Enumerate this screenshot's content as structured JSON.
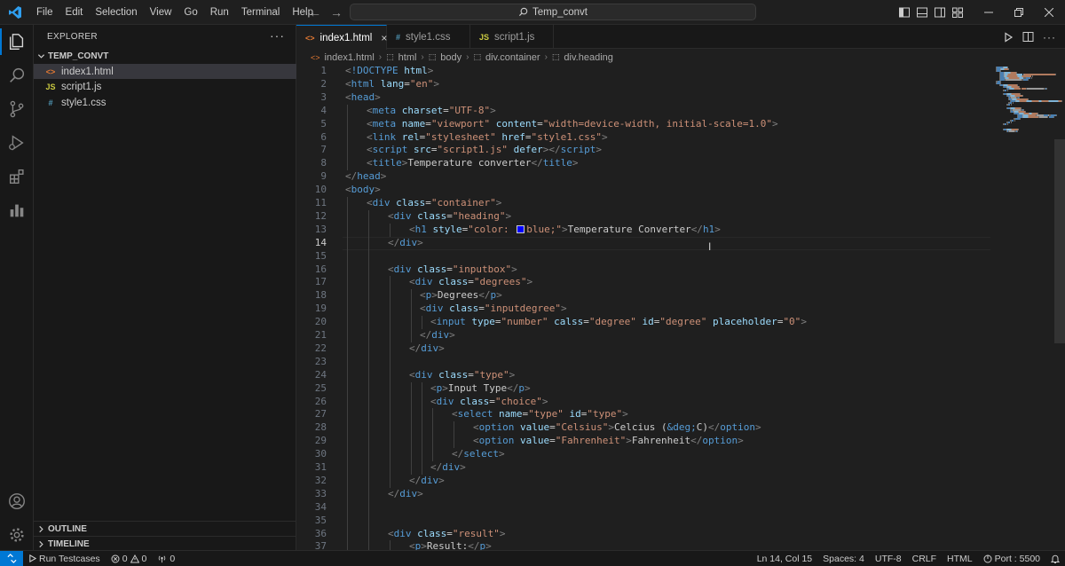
{
  "menu": [
    "File",
    "Edit",
    "Selection",
    "View",
    "Go",
    "Run",
    "Terminal",
    "Help"
  ],
  "command_center": {
    "text": "Temp_convt"
  },
  "sidebar": {
    "title": "EXPLORER",
    "folder": "TEMP_CONVT",
    "files": [
      {
        "icon": "<>",
        "name": "index1.html",
        "color": "#e37933"
      },
      {
        "icon": "JS",
        "name": "script1.js",
        "color": "#cbcb41"
      },
      {
        "icon": "#",
        "name": "style1.css",
        "color": "#519aba"
      }
    ],
    "outline": "OUTLINE",
    "timeline": "TIMELINE"
  },
  "tabs": [
    {
      "icon": "<>",
      "label": "index1.html",
      "color": "#e37933"
    },
    {
      "icon": "#",
      "label": "style1.css",
      "color": "#519aba"
    },
    {
      "icon": "JS",
      "label": "script1.js",
      "color": "#cbcb41"
    }
  ],
  "breadcrumb": [
    "index1.html",
    "html",
    "body",
    "div.container",
    "div.heading"
  ],
  "status": {
    "run_testcases": "Run Testcases",
    "errors": "0",
    "warnings": "0",
    "ports": "0",
    "position": "Ln 14, Col 15",
    "spaces": "Spaces: 4",
    "encoding": "UTF-8",
    "eol": "CRLF",
    "language": "HTML",
    "port": "Port : 5500"
  },
  "code": {
    "current_line": 14,
    "lines": [
      {
        "n": "1",
        "indent": 0,
        "parts": [
          [
            "t",
            "<"
          ],
          [
            "tg",
            "!DOCTYPE"
          ],
          [
            "tx",
            " "
          ],
          [
            "at",
            "html"
          ],
          [
            "t",
            ">"
          ]
        ]
      },
      {
        "n": "2",
        "indent": 0,
        "parts": [
          [
            "t",
            "<"
          ],
          [
            "tg",
            "html"
          ],
          [
            "tx",
            " "
          ],
          [
            "at",
            "lang"
          ],
          [
            "tx",
            "="
          ],
          [
            "st",
            "\"en\""
          ],
          [
            "t",
            ">"
          ]
        ]
      },
      {
        "n": "3",
        "indent": 0,
        "parts": [
          [
            "t",
            "<"
          ],
          [
            "tg",
            "head"
          ],
          [
            "t",
            ">"
          ]
        ]
      },
      {
        "n": "4",
        "indent": 1,
        "parts": [
          [
            "t",
            "<"
          ],
          [
            "tg",
            "meta"
          ],
          [
            "tx",
            " "
          ],
          [
            "at",
            "charset"
          ],
          [
            "tx",
            "="
          ],
          [
            "st",
            "\"UTF-8\""
          ],
          [
            "t",
            ">"
          ]
        ]
      },
      {
        "n": "5",
        "indent": 1,
        "parts": [
          [
            "t",
            "<"
          ],
          [
            "tg",
            "meta"
          ],
          [
            "tx",
            " "
          ],
          [
            "at",
            "name"
          ],
          [
            "tx",
            "="
          ],
          [
            "st",
            "\"viewport\""
          ],
          [
            "tx",
            " "
          ],
          [
            "at",
            "content"
          ],
          [
            "tx",
            "="
          ],
          [
            "st",
            "\"width=device-width, initial-scale=1.0\""
          ],
          [
            "t",
            ">"
          ]
        ]
      },
      {
        "n": "6",
        "indent": 1,
        "parts": [
          [
            "t",
            "<"
          ],
          [
            "tg",
            "link"
          ],
          [
            "tx",
            " "
          ],
          [
            "at",
            "rel"
          ],
          [
            "tx",
            "="
          ],
          [
            "st",
            "\"stylesheet\""
          ],
          [
            "tx",
            " "
          ],
          [
            "at",
            "href"
          ],
          [
            "tx",
            "="
          ],
          [
            "st",
            "\"style1.css\""
          ],
          [
            "t",
            ">"
          ]
        ]
      },
      {
        "n": "7",
        "indent": 1,
        "parts": [
          [
            "t",
            "<"
          ],
          [
            "tg",
            "script"
          ],
          [
            "tx",
            " "
          ],
          [
            "at",
            "src"
          ],
          [
            "tx",
            "="
          ],
          [
            "st",
            "\"script1.js\""
          ],
          [
            "tx",
            " "
          ],
          [
            "at",
            "defer"
          ],
          [
            "t",
            "></"
          ],
          [
            "tg",
            "script"
          ],
          [
            "t",
            ">"
          ]
        ]
      },
      {
        "n": "8",
        "indent": 1,
        "parts": [
          [
            "t",
            "<"
          ],
          [
            "tg",
            "title"
          ],
          [
            "t",
            ">"
          ],
          [
            "tx",
            "Temperature converter"
          ],
          [
            "t",
            "</"
          ],
          [
            "tg",
            "title"
          ],
          [
            "t",
            ">"
          ]
        ]
      },
      {
        "n": "9",
        "indent": 0,
        "parts": [
          [
            "t",
            "</"
          ],
          [
            "tg",
            "head"
          ],
          [
            "t",
            ">"
          ]
        ]
      },
      {
        "n": "10",
        "indent": 0,
        "parts": [
          [
            "t",
            "<"
          ],
          [
            "tg",
            "body"
          ],
          [
            "t",
            ">"
          ]
        ]
      },
      {
        "n": "11",
        "indent": 1,
        "parts": [
          [
            "t",
            "<"
          ],
          [
            "tg",
            "div"
          ],
          [
            "tx",
            " "
          ],
          [
            "at",
            "class"
          ],
          [
            "tx",
            "="
          ],
          [
            "st",
            "\"container\""
          ],
          [
            "t",
            ">"
          ]
        ]
      },
      {
        "n": "12",
        "indent": 2,
        "parts": [
          [
            "t",
            "<"
          ],
          [
            "tg",
            "div"
          ],
          [
            "tx",
            " "
          ],
          [
            "at",
            "class"
          ],
          [
            "tx",
            "="
          ],
          [
            "st",
            "\"heading\""
          ],
          [
            "t",
            ">"
          ]
        ]
      },
      {
        "n": "13",
        "indent": 3,
        "parts": [
          [
            "t",
            "<"
          ],
          [
            "tg",
            "h1"
          ],
          [
            "tx",
            " "
          ],
          [
            "at",
            "style"
          ],
          [
            "tx",
            "="
          ],
          [
            "st",
            "\"color: "
          ],
          [
            "swatch",
            ""
          ],
          [
            "st",
            "blue;\""
          ],
          [
            "t",
            ">"
          ],
          [
            "tx",
            "Temperature Converter"
          ],
          [
            "t",
            "</"
          ],
          [
            "tg",
            "h1"
          ],
          [
            "t",
            ">"
          ]
        ]
      },
      {
        "n": "14",
        "indent": 2,
        "parts": [
          [
            "t",
            "</"
          ],
          [
            "tg",
            "div"
          ],
          [
            "t",
            ">"
          ]
        ]
      },
      {
        "n": "15",
        "indent": 0,
        "parts": []
      },
      {
        "n": "16",
        "indent": 2,
        "parts": [
          [
            "t",
            "<"
          ],
          [
            "tg",
            "div"
          ],
          [
            "tx",
            " "
          ],
          [
            "at",
            "class"
          ],
          [
            "tx",
            "="
          ],
          [
            "st",
            "\"inputbox\""
          ],
          [
            "t",
            ">"
          ]
        ]
      },
      {
        "n": "17",
        "indent": 3,
        "parts": [
          [
            "t",
            "<"
          ],
          [
            "tg",
            "div"
          ],
          [
            "tx",
            " "
          ],
          [
            "at",
            "class"
          ],
          [
            "tx",
            "="
          ],
          [
            "st",
            "\"degrees\""
          ],
          [
            "t",
            ">"
          ]
        ]
      },
      {
        "n": "18",
        "indent": 3.5,
        "parts": [
          [
            "t",
            "<"
          ],
          [
            "tg",
            "p"
          ],
          [
            "t",
            ">"
          ],
          [
            "tx",
            "Degrees"
          ],
          [
            "t",
            "</"
          ],
          [
            "tg",
            "p"
          ],
          [
            "t",
            ">"
          ]
        ]
      },
      {
        "n": "19",
        "indent": 3.5,
        "parts": [
          [
            "t",
            "<"
          ],
          [
            "tg",
            "div"
          ],
          [
            "tx",
            " "
          ],
          [
            "at",
            "class"
          ],
          [
            "tx",
            "="
          ],
          [
            "st",
            "\"inputdegree\""
          ],
          [
            "t",
            ">"
          ]
        ]
      },
      {
        "n": "20",
        "indent": 4,
        "parts": [
          [
            "t",
            "<"
          ],
          [
            "tg",
            "input"
          ],
          [
            "tx",
            " "
          ],
          [
            "at",
            "type"
          ],
          [
            "tx",
            "="
          ],
          [
            "st",
            "\"number\""
          ],
          [
            "tx",
            " "
          ],
          [
            "at",
            "calss"
          ],
          [
            "tx",
            "="
          ],
          [
            "st",
            "\"degree\""
          ],
          [
            "tx",
            " "
          ],
          [
            "at",
            "id"
          ],
          [
            "tx",
            "="
          ],
          [
            "st",
            "\"degree\""
          ],
          [
            "tx",
            " "
          ],
          [
            "at",
            "placeholder"
          ],
          [
            "tx",
            "="
          ],
          [
            "st",
            "\"0\""
          ],
          [
            "t",
            ">"
          ]
        ]
      },
      {
        "n": "21",
        "indent": 3.5,
        "parts": [
          [
            "t",
            "</"
          ],
          [
            "tg",
            "div"
          ],
          [
            "t",
            ">"
          ]
        ]
      },
      {
        "n": "22",
        "indent": 3,
        "parts": [
          [
            "t",
            "</"
          ],
          [
            "tg",
            "div"
          ],
          [
            "t",
            ">"
          ]
        ]
      },
      {
        "n": "23",
        "indent": 0,
        "parts": []
      },
      {
        "n": "24",
        "indent": 3,
        "parts": [
          [
            "t",
            "<"
          ],
          [
            "tg",
            "div"
          ],
          [
            "tx",
            " "
          ],
          [
            "at",
            "class"
          ],
          [
            "tx",
            "="
          ],
          [
            "st",
            "\"type\""
          ],
          [
            "t",
            ">"
          ]
        ]
      },
      {
        "n": "25",
        "indent": 4,
        "parts": [
          [
            "t",
            "<"
          ],
          [
            "tg",
            "p"
          ],
          [
            "t",
            ">"
          ],
          [
            "tx",
            "Input Type"
          ],
          [
            "t",
            "</"
          ],
          [
            "tg",
            "p"
          ],
          [
            "t",
            ">"
          ]
        ]
      },
      {
        "n": "26",
        "indent": 4,
        "parts": [
          [
            "t",
            "<"
          ],
          [
            "tg",
            "div"
          ],
          [
            "tx",
            " "
          ],
          [
            "at",
            "class"
          ],
          [
            "tx",
            "="
          ],
          [
            "st",
            "\"choice\""
          ],
          [
            "t",
            ">"
          ]
        ]
      },
      {
        "n": "27",
        "indent": 5,
        "parts": [
          [
            "t",
            "<"
          ],
          [
            "tg",
            "select"
          ],
          [
            "tx",
            " "
          ],
          [
            "at",
            "name"
          ],
          [
            "tx",
            "="
          ],
          [
            "st",
            "\"type\""
          ],
          [
            "tx",
            " "
          ],
          [
            "at",
            "id"
          ],
          [
            "tx",
            "="
          ],
          [
            "st",
            "\"type\""
          ],
          [
            "t",
            ">"
          ]
        ]
      },
      {
        "n": "28",
        "indent": 6,
        "parts": [
          [
            "t",
            "<"
          ],
          [
            "tg",
            "option"
          ],
          [
            "tx",
            " "
          ],
          [
            "at",
            "value"
          ],
          [
            "tx",
            "="
          ],
          [
            "st",
            "\"Celsius\""
          ],
          [
            "t",
            ">"
          ],
          [
            "tx",
            "Celcius ("
          ],
          [
            "kw",
            "&deg;"
          ],
          [
            "tx",
            "C)"
          ],
          [
            "t",
            "</"
          ],
          [
            "tg",
            "option"
          ],
          [
            "t",
            ">"
          ]
        ]
      },
      {
        "n": "29",
        "indent": 6,
        "parts": [
          [
            "t",
            "<"
          ],
          [
            "tg",
            "option"
          ],
          [
            "tx",
            " "
          ],
          [
            "at",
            "value"
          ],
          [
            "tx",
            "="
          ],
          [
            "st",
            "\"Fahrenheit\""
          ],
          [
            "t",
            ">"
          ],
          [
            "tx",
            "Fahrenheit"
          ],
          [
            "t",
            "</"
          ],
          [
            "tg",
            "option"
          ],
          [
            "t",
            ">"
          ]
        ]
      },
      {
        "n": "30",
        "indent": 5,
        "parts": [
          [
            "t",
            "</"
          ],
          [
            "tg",
            "select"
          ],
          [
            "t",
            ">"
          ]
        ]
      },
      {
        "n": "31",
        "indent": 4,
        "parts": [
          [
            "t",
            "</"
          ],
          [
            "tg",
            "div"
          ],
          [
            "t",
            ">"
          ]
        ]
      },
      {
        "n": "32",
        "indent": 3,
        "parts": [
          [
            "t",
            "</"
          ],
          [
            "tg",
            "div"
          ],
          [
            "t",
            ">"
          ]
        ]
      },
      {
        "n": "33",
        "indent": 2,
        "parts": [
          [
            "t",
            "</"
          ],
          [
            "tg",
            "div"
          ],
          [
            "t",
            ">"
          ]
        ]
      },
      {
        "n": "34",
        "indent": 0,
        "parts": []
      },
      {
        "n": "35",
        "indent": 0,
        "parts": []
      },
      {
        "n": "36",
        "indent": 2,
        "parts": [
          [
            "t",
            "<"
          ],
          [
            "tg",
            "div"
          ],
          [
            "tx",
            " "
          ],
          [
            "at",
            "class"
          ],
          [
            "tx",
            "="
          ],
          [
            "st",
            "\"result\""
          ],
          [
            "t",
            ">"
          ]
        ]
      },
      {
        "n": "37",
        "indent": 3,
        "parts": [
          [
            "t",
            "<"
          ],
          [
            "tg",
            "p"
          ],
          [
            "t",
            ">"
          ],
          [
            "tx",
            "Result:"
          ],
          [
            "t",
            "</"
          ],
          [
            "tg",
            "p"
          ],
          [
            "t",
            ">"
          ]
        ]
      }
    ]
  }
}
